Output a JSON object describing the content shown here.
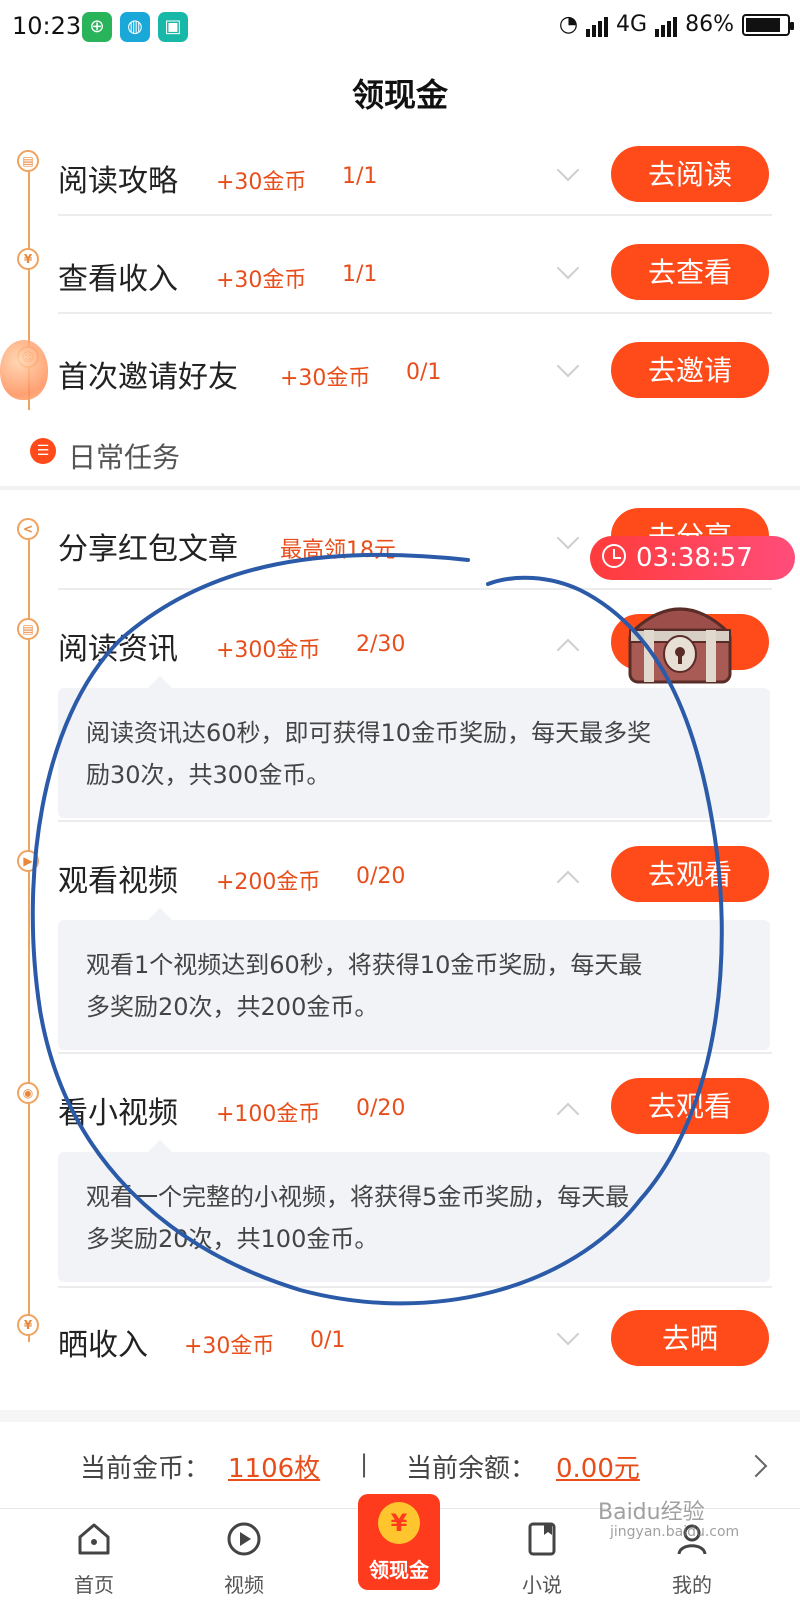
{
  "status_bar": {
    "time": "10:23",
    "network": "4G",
    "battery": "86%",
    "battery_level": 0.86
  },
  "page": {
    "title": "领现金"
  },
  "tasks_top": [
    {
      "name": "阅读攻略",
      "reward": "+30金币",
      "progress": "1/1",
      "button": "去阅读",
      "icon": "book-icon"
    },
    {
      "name": "查看收入",
      "reward": "+30金币",
      "progress": "1/1",
      "button": "去查看",
      "icon": "yuan-icon"
    },
    {
      "name": "首次邀请好友",
      "reward": "+30金币",
      "progress": "0/1",
      "button": "去邀请",
      "icon": "user-icon"
    }
  ],
  "daily_section": {
    "title": "日常任务"
  },
  "tasks_daily": [
    {
      "name": "分享红包文章",
      "reward": "最高领18元",
      "progress": "",
      "button": "去分享",
      "icon": "share-icon"
    },
    {
      "name": "阅读资讯",
      "reward": "+300金币",
      "progress": "2/30",
      "button": "去阅读",
      "icon": "book-icon",
      "description": [
        "阅读资讯达60秒，即可获得10金币奖励，每天最多奖",
        "励30次，共300金币。"
      ]
    },
    {
      "name": "观看视频",
      "reward": "+200金币",
      "progress": "0/20",
      "button": "去观看",
      "icon": "play-icon",
      "description": [
        "观看1个视频达到60秒，将获得10金币奖励，每天最",
        "多奖励20次，共200金币。"
      ]
    },
    {
      "name": "看小视频",
      "reward": "+100金币",
      "progress": "0/20",
      "button": "去观看",
      "icon": "record-icon",
      "description": [
        "观看一个完整的小视频，将获得5金币奖励，每天最",
        "多奖励20次，共100金币。"
      ]
    },
    {
      "name": "晒收入",
      "reward": "+30金币",
      "progress": "0/1",
      "button": "去晒",
      "icon": "yuan-icon"
    }
  ],
  "timer": {
    "text": "03:38:57"
  },
  "balance": {
    "coins_label": "当前金币：",
    "coins_value": "1106枚",
    "separator": "|",
    "cash_label": "当前余额：",
    "cash_value": "0.00元"
  },
  "nav": {
    "items": [
      "首页",
      "视频",
      "小说",
      "我的"
    ],
    "center_label": "领现金",
    "center_icon": "¥"
  },
  "watermark": {
    "text": "Baidu经验",
    "sub": "jingyan.baidu.com"
  },
  "colors": {
    "accent": "#ff4a1a",
    "reward_text": "#e84e1b",
    "timeline": "#f0a35e",
    "annotation": "#2b5aa8"
  }
}
